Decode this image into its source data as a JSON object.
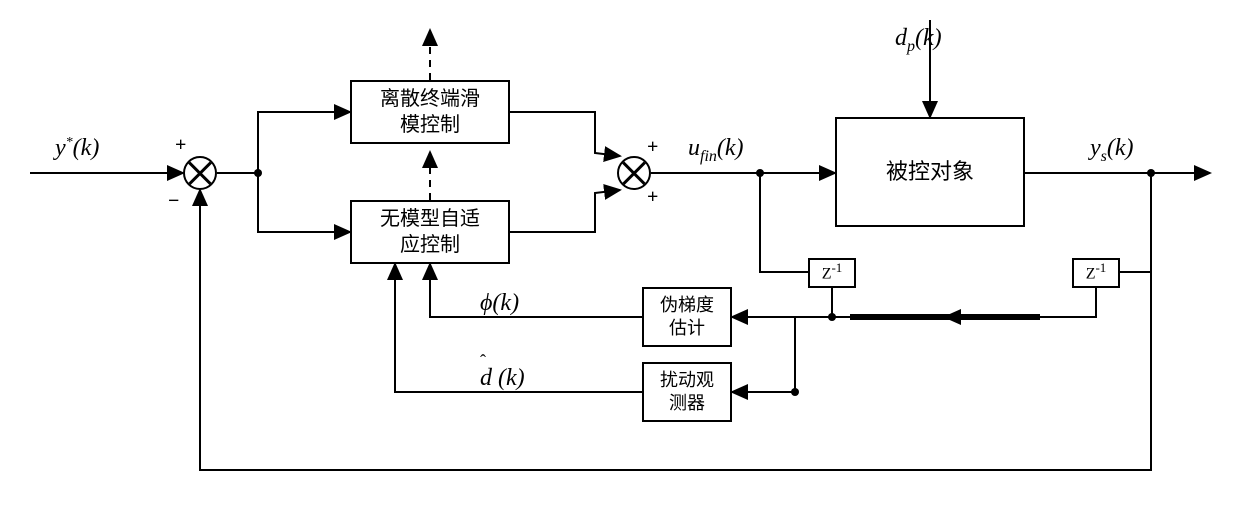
{
  "reference_label": "y*(k)",
  "disturbance_label": "d_p(k)",
  "control_signal_label": "u_fin(k)",
  "output_label": "y_s(k)",
  "pseudograd_signal_label": "φ(k)",
  "disturbance_est_label": "d̂(k)",
  "blocks": {
    "terminal_sliding": "离散终端滑\n模控制",
    "mfac": "无模型自适\n应控制",
    "plant": "被控对象",
    "pseudograd_est": "伪梯度\n估计",
    "dist_observer": "扰动观\n测器",
    "delay": "Z⁻¹"
  },
  "signs": {
    "sum_error_plus": "+",
    "sum_error_minus": "−",
    "sum_control_top_plus": "+",
    "sum_control_bottom_plus": "+"
  },
  "chart_data": {
    "type": "block-diagram",
    "description": "Control block diagram: tracking error feeds parallel Discrete Terminal Sliding Mode Control and Model-Free Adaptive Control blocks; their outputs sum to u_fin(k) driving the plant under disturbance d_p(k); plant output y_s(k) and delayed u_fin(k) go to a Pseudo-Gradient Estimator producing φ(k) and a Disturbance Observer producing d̂(k), both fed back to the MFAC block; unity output feedback closes the outer loop.",
    "nodes": [
      {
        "id": "ref_in",
        "kind": "input",
        "label_key": "reference_label"
      },
      {
        "id": "sum_error",
        "kind": "summation",
        "inputs": [
          {
            "from": "ref_in",
            "sign": "+"
          },
          {
            "from": "y_out",
            "sign": "-"
          }
        ]
      },
      {
        "id": "terminal_sliding",
        "kind": "block",
        "label_key": "blocks.terminal_sliding"
      },
      {
        "id": "mfac",
        "kind": "block",
        "label_key": "blocks.mfac"
      },
      {
        "id": "sum_control",
        "kind": "summation",
        "inputs": [
          {
            "from": "terminal_sliding",
            "sign": "+"
          },
          {
            "from": "mfac",
            "sign": "+"
          }
        ]
      },
      {
        "id": "u_fin",
        "kind": "signal",
        "label_key": "control_signal_label"
      },
      {
        "id": "disturb_in",
        "kind": "input",
        "label_key": "disturbance_label"
      },
      {
        "id": "plant",
        "kind": "block",
        "label_key": "blocks.plant"
      },
      {
        "id": "y_out",
        "kind": "output",
        "label_key": "output_label"
      },
      {
        "id": "delay_u",
        "kind": "block",
        "label_key": "blocks.delay"
      },
      {
        "id": "delay_y",
        "kind": "block",
        "label_key": "blocks.delay"
      },
      {
        "id": "pseudograd_est",
        "kind": "block",
        "label_key": "blocks.pseudograd_est",
        "output_label_key": "pseudograd_signal_label"
      },
      {
        "id": "dist_observer",
        "kind": "block",
        "label_key": "blocks.dist_observer",
        "output_label_key": "disturbance_est_label"
      }
    ],
    "edges": [
      {
        "from": "ref_in",
        "to": "sum_error"
      },
      {
        "from": "sum_error",
        "to": "terminal_sliding"
      },
      {
        "from": "sum_error",
        "to": "mfac"
      },
      {
        "from": "terminal_sliding",
        "to": "sum_control"
      },
      {
        "from": "mfac",
        "to": "sum_control"
      },
      {
        "from": "sum_control",
        "to": "plant",
        "via": "u_fin"
      },
      {
        "from": "disturb_in",
        "to": "plant"
      },
      {
        "from": "plant",
        "to": "y_out"
      },
      {
        "from": "u_fin",
        "to": "delay_u"
      },
      {
        "from": "y_out",
        "to": "delay_y"
      },
      {
        "from": "delay_u",
        "to": "pseudograd_est"
      },
      {
        "from": "delay_u",
        "to": "dist_observer"
      },
      {
        "from": "delay_y",
        "to": "pseudograd_est"
      },
      {
        "from": "delay_y",
        "to": "dist_observer"
      },
      {
        "from": "pseudograd_est",
        "to": "mfac",
        "signal": "φ(k)"
      },
      {
        "from": "dist_observer",
        "to": "mfac",
        "signal": "d̂(k)"
      },
      {
        "from": "terminal_sliding",
        "to": "ambient",
        "style": "dashed"
      },
      {
        "from": "mfac",
        "to": "terminal_sliding",
        "style": "dashed",
        "note": "internal link"
      },
      {
        "from": "y_out",
        "to": "sum_error",
        "note": "unity feedback"
      }
    ]
  }
}
